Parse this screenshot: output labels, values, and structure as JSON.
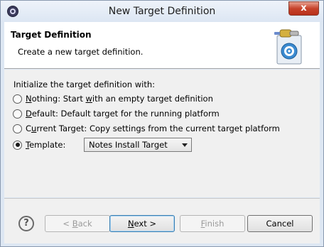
{
  "window": {
    "title": "New Target Definition",
    "close_label": "x"
  },
  "banner": {
    "title": "Target Definition",
    "description": "Create a new target definition."
  },
  "content": {
    "init_label": "Initialize the target definition with:",
    "options": [
      {
        "key": "N",
        "rest": "othing: Start ",
        "key2": "w",
        "rest2": "ith an empty target definition",
        "checked": false
      },
      {
        "key": "D",
        "rest": "efault: Default target for the running platform",
        "checked": false
      },
      {
        "pre": "C",
        "key": "u",
        "rest": "rrent Target: Copy settings from the current target platform",
        "checked": false
      },
      {
        "key": "T",
        "rest": "emplate:",
        "checked": true
      }
    ],
    "template_select": {
      "value": "Notes Install Target"
    }
  },
  "buttons": {
    "help": "?",
    "back": {
      "pre": "< ",
      "key": "B",
      "rest": "ack"
    },
    "next": {
      "key": "N",
      "rest": "ext >"
    },
    "finish": {
      "key": "F",
      "rest": "inish"
    },
    "cancel": "Cancel"
  }
}
